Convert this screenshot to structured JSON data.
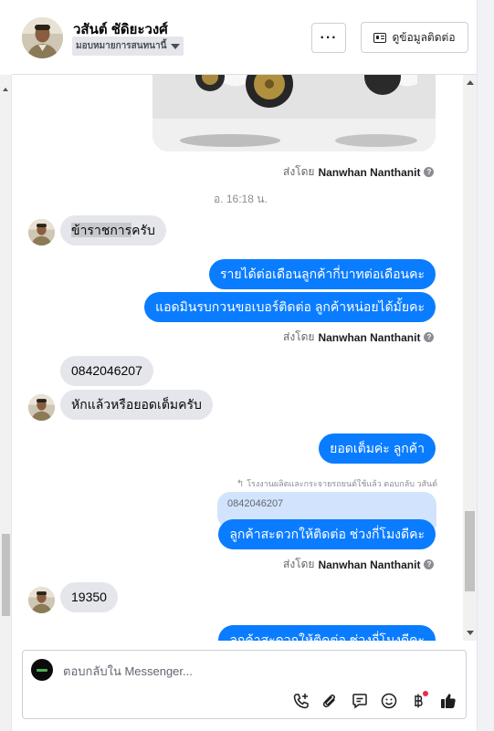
{
  "header": {
    "contact_name": "วสันต์ ชัดิยะวงศ์",
    "assign_label": "มอบหมายการสนทนานี้",
    "more_label": "···",
    "contact_info_label": "ดูข้อมูลติดต่อ"
  },
  "messages": {
    "sent_by_prefix": "ส่งโดย",
    "sender_name": "Nanwhan Nanthanit",
    "timestamp": "อ. 16:18 น.",
    "in_1_highlight": "ข้าราชการ",
    "in_1_rest": "ครับ",
    "out_1": "รายได้ต่อเดือนลูกค้ากี่บาทต่อเดือนคะ",
    "out_2": "แอดมินรบกวนขอเบอร์ติดต่อ ลูกค้าหน่อยได้มั้ยคะ",
    "in_2": "0842046207",
    "in_3": "หักแล้วหรือยอดเต็มครับ",
    "out_3": "ยอดเต็มค่ะ ลูกค้า",
    "reply_meta": "โรงงานผลิตและกระจายรถยนต์ใช้แล้ว ตอบกลับ วสันต์",
    "quoted_text": "0842046207",
    "out_4": "ลูกค้าสะดวกให้ติดต่อ ช่วงกี่โมงดีคะ",
    "in_4": "19350",
    "out_5_partial": "ลูกค้าสะดวกให้ติดต่อ ช่วงกี่โมงดีคะ"
  },
  "composer": {
    "placeholder": "ตอบกลับใน Messenger..."
  },
  "colors": {
    "outgoing_bubble": "#0a7cff",
    "incoming_bubble": "#e4e6eb",
    "like_icon": "#1c1e21",
    "notification_dot": "#f02849"
  },
  "icons": [
    "phone-add-icon",
    "attach-icon",
    "saved-reply-icon",
    "emoji-icon",
    "baht-icon",
    "like-icon"
  ]
}
